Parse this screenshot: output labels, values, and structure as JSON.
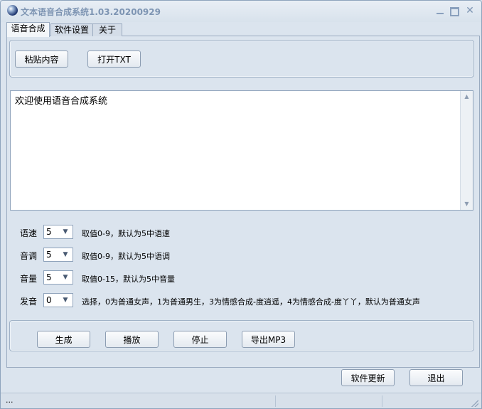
{
  "window": {
    "title": "文本语音合成系统1.03.20200929"
  },
  "tabs": [
    "语音合成",
    "软件设置",
    "关于"
  ],
  "toolbar": {
    "paste_label": "粘贴内容",
    "open_txt_label": "打开TXT"
  },
  "editor": {
    "text": "欢迎使用语音合成系统"
  },
  "settings": {
    "speed": {
      "label": "语速",
      "value": "5",
      "hint": "取值0-9，默认为5中语速"
    },
    "pitch": {
      "label": "音调",
      "value": "5",
      "hint": "取值0-9，默认为5中语调"
    },
    "volume": {
      "label": "音量",
      "value": "5",
      "hint": "取值0-15，默认为5中音量"
    },
    "voice": {
      "label": "发音",
      "value": "0",
      "hint": "选择，0为普通女声，1为普通男生，3为情感合成-度逍遥，4为情感合成-度丫丫，默认为普通女声"
    }
  },
  "actions": {
    "generate_label": "生成",
    "play_label": "播放",
    "stop_label": "停止",
    "export_label": "导出MP3"
  },
  "footer": {
    "update_label": "软件更新",
    "exit_label": "退出"
  },
  "statusbar": {
    "text": "..."
  },
  "icons": {
    "app": "globe-icon",
    "minimize": "minimize-icon",
    "maximize": "maximize-icon",
    "close": "close-icon"
  }
}
